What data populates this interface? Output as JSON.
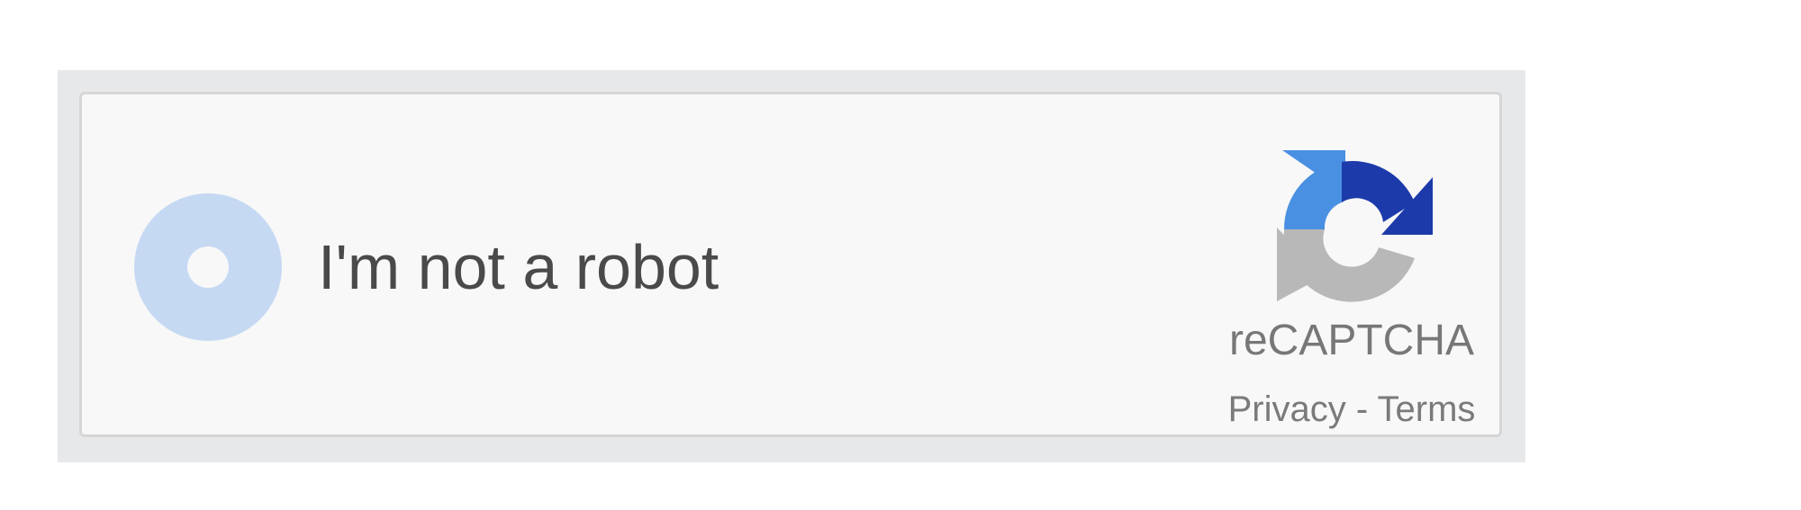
{
  "captcha": {
    "label": "I'm not a robot",
    "brand": "reCAPTCHA",
    "links": {
      "privacy": "Privacy",
      "separator": " - ",
      "terms": "Terms"
    },
    "logo_icon": "recaptcha-logo-icon",
    "checkbox_state": "loading",
    "colors": {
      "spinner": "#c6d9f3",
      "logo_light_blue": "#4a90e2",
      "logo_dark_blue": "#1c3aa9",
      "logo_gray": "#b8b8b8",
      "text": "#4a4a4a",
      "muted_text": "#777777"
    }
  }
}
